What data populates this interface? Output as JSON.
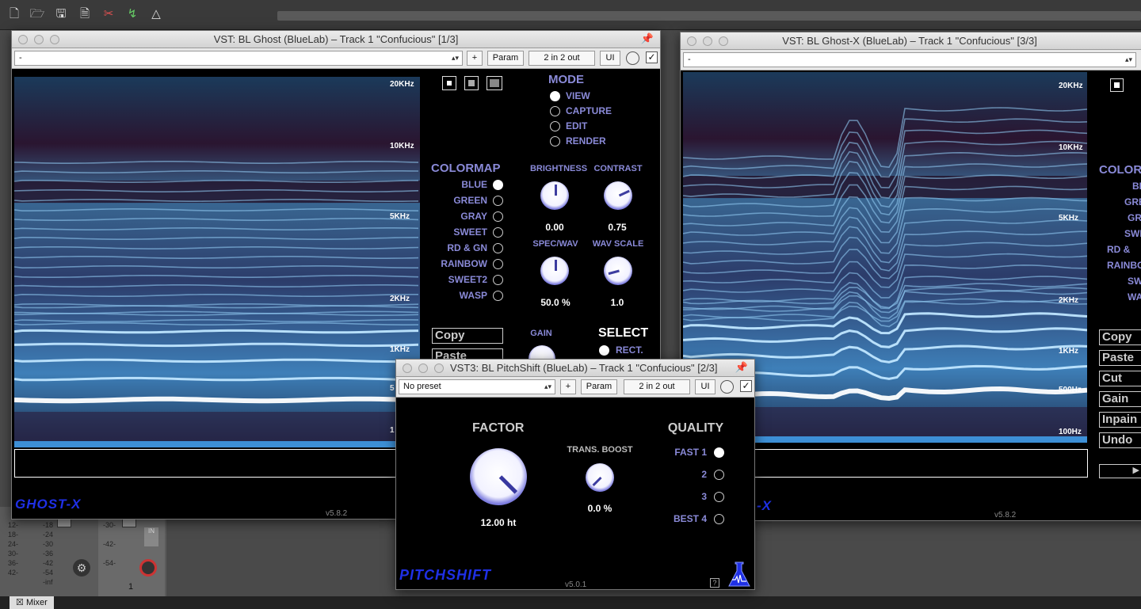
{
  "daw": {
    "toolbar_icons": [
      "new-project-icon",
      "open-project-icon",
      "save-project-icon",
      "new-track-icon",
      "cut-icon",
      "ripple-edit-icon",
      "snap-icon"
    ],
    "track_number": "1",
    "mixer_label": "Mixer",
    "mixer_close": "☒",
    "meter_scale_left": [
      "-18",
      "-24",
      "-30",
      "-36",
      "-42",
      "-54",
      "-inf"
    ],
    "meter_scale_mid": [
      "-30-",
      "-42-",
      "-54-"
    ],
    "meter_db": [
      "12-",
      "18-",
      "24-",
      "30-",
      "36-",
      "42-",
      "54-"
    ],
    "meter_db2": [
      "-18",
      "-24",
      "-30",
      "-36",
      "-42",
      "-54",
      "-inf"
    ],
    "io_label": "IN"
  },
  "ghost_window": {
    "title": "VST: BL Ghost (BlueLab) – Track 1 \"Confucious\" [1/3]",
    "preset": "-",
    "plus": "+",
    "param_label": "Param",
    "io_label": "2 in 2 out",
    "ui_label": "UI",
    "check": "✓",
    "freq_labels": [
      "20KHz",
      "10KHz",
      "5KHz",
      "2KHz",
      "1KHz",
      "5",
      "1"
    ],
    "mode_title": "MODE",
    "modes": [
      {
        "label": "VIEW",
        "selected": true
      },
      {
        "label": "CAPTURE",
        "selected": false
      },
      {
        "label": "EDIT",
        "selected": false
      },
      {
        "label": "RENDER",
        "selected": false
      }
    ],
    "colormap_title": "COLORMAP",
    "colormaps": [
      {
        "label": "BLUE",
        "selected": true
      },
      {
        "label": "GREEN",
        "selected": false
      },
      {
        "label": "GRAY",
        "selected": false
      },
      {
        "label": "SWEET",
        "selected": false
      },
      {
        "label": "RD & GN",
        "selected": false
      },
      {
        "label": "RAINBOW",
        "selected": false
      },
      {
        "label": "SWEET2",
        "selected": false
      },
      {
        "label": "WASP",
        "selected": false
      }
    ],
    "brightness_label": "BRIGHTNESS",
    "brightness_value": "0.00",
    "contrast_label": "CONTRAST",
    "contrast_value": "0.75",
    "specwav_label": "SPEC/WAV",
    "specwav_value": "50.0 %",
    "wavscale_label": "WAV SCALE",
    "wavscale_value": "1.0",
    "gain_label": "GAIN",
    "select_title": "SELECT",
    "select_rect": "RECT.",
    "copy_label": "Copy",
    "paste_label": "Paste",
    "logo": "GHOST-X",
    "version": "v5.8.2"
  },
  "ghostx_window": {
    "title": "VST: BL Ghost-X (BlueLab) – Track 1 \"Confucious\" [3/3]",
    "preset": "-",
    "freq_labels": [
      "20KHz",
      "10KHz",
      "5KHz",
      "2KHz",
      "1KHz",
      "500Hz",
      "100Hz"
    ],
    "colormap_title": "COLORM",
    "colormaps": [
      "BL",
      "GRE",
      "GR",
      "SWE",
      "RD &",
      "RAINBO",
      "SWEE",
      "WA"
    ],
    "edit_buttons": [
      "Copy",
      "Paste",
      "Cut",
      "Gain",
      "Inpain",
      "Undo"
    ],
    "logo_tail": "-X",
    "version": "v5.8.2"
  },
  "pitch_window": {
    "title": "VST3: BL PitchShift (BlueLab) – Track 1 \"Confucious\" [2/3]",
    "preset": "No preset",
    "plus": "+",
    "param_label": "Param",
    "io_label": "2 in 2 out",
    "ui_label": "UI",
    "check": "✓",
    "factor_label": "FACTOR",
    "factor_value": "12.00 ht",
    "boost_label": "TRANS. BOOST",
    "boost_value": "0.0 %",
    "quality_label": "QUALITY",
    "qualities": [
      {
        "label": "FAST 1",
        "selected": true
      },
      {
        "label": "2",
        "selected": false
      },
      {
        "label": "3",
        "selected": false
      },
      {
        "label": "BEST 4",
        "selected": false
      }
    ],
    "logo": "PITCHSHIFT",
    "version": "v5.0.1",
    "help": "?"
  },
  "colors": {
    "accent_purple": "#8a8ad8",
    "logo_blue": "#1f30e6",
    "spectrogram_deep": "#241030",
    "spectrogram_light": "#bfe6ff"
  }
}
